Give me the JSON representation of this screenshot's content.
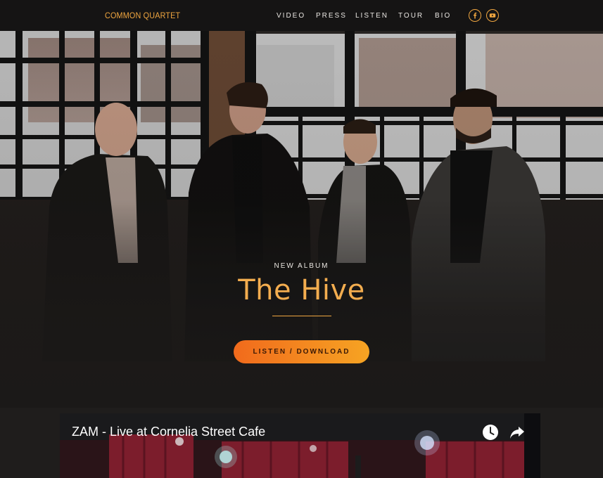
{
  "site": {
    "brand": "COMMON QUARTET",
    "menu": [
      "VIDEO",
      "PRESS",
      "LISTEN",
      "TOUR",
      "BIO"
    ],
    "social": [
      {
        "name": "facebook-icon",
        "glyph": "f"
      },
      {
        "name": "youtube-icon"
      }
    ],
    "accent_color": "#f0a640"
  },
  "hero": {
    "kicker": "NEW ALBUM",
    "album_title": "The Hive",
    "cta_label": "LISTEN / DOWNLOAD",
    "cta_colors": [
      "#f16a1c",
      "#f6a423"
    ]
  },
  "video": {
    "title": "ZAM - Live at Cornelia Street Cafe",
    "icons": [
      "clock-icon",
      "share-icon"
    ]
  }
}
